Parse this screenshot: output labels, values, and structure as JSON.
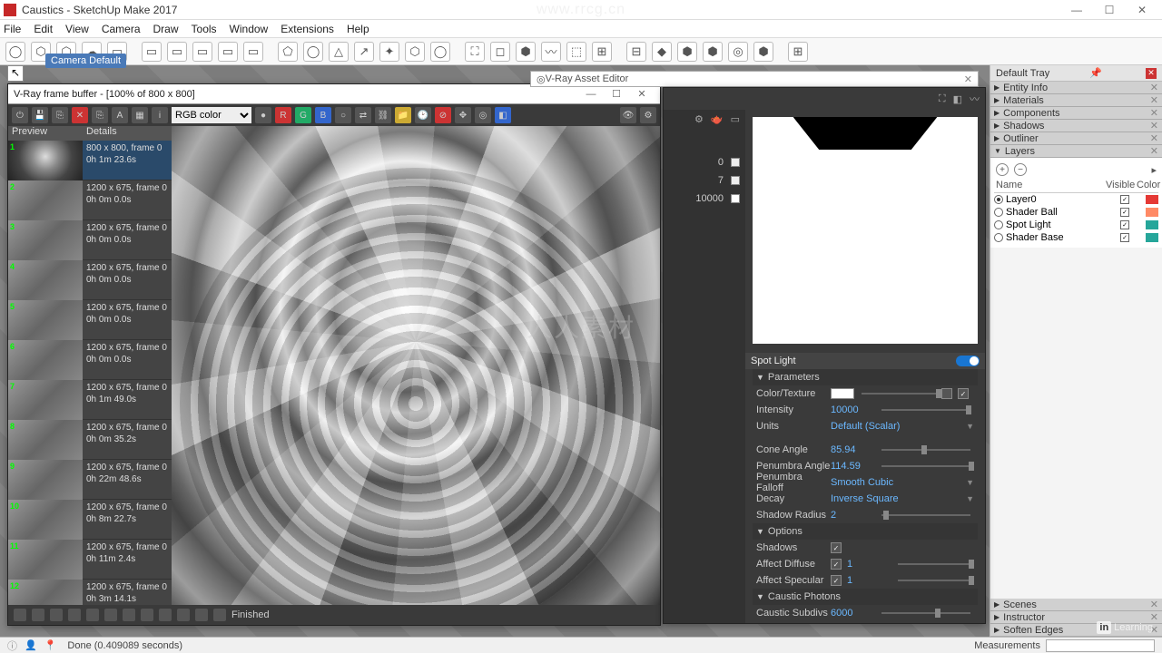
{
  "app": {
    "title": "Caustics - SketchUp Make 2017",
    "win_buttons": [
      "—",
      "☐",
      "✕"
    ]
  },
  "menu": [
    "File",
    "Edit",
    "View",
    "Camera",
    "Draw",
    "Tools",
    "Window",
    "Extensions",
    "Help"
  ],
  "camtip": "Camera Default",
  "toolbar_icons": [
    "◯",
    "⬡",
    "⬡",
    "☁",
    "▭",
    "▭",
    "▭",
    "▭",
    "▭",
    "▭",
    "⬠",
    "◯",
    "△",
    "↗",
    "✦",
    "⬡",
    "◯",
    "⛶",
    "◻",
    "⬢",
    "〰",
    "⬚",
    "⊞",
    "⊟",
    "◆",
    "⬢",
    "⬢",
    "◎",
    "⬢",
    "⊞"
  ],
  "vfb": {
    "title": "V-Ray frame buffer - [100% of 800 x 800]",
    "channel": "RGB color",
    "previews_hdr": {
      "c1": "Preview",
      "c2": "Details"
    },
    "list": [
      {
        "n": "1",
        "bw": true,
        "l1": "800 x 800, frame 0",
        "l2": "0h 1m 23.6s",
        "sel": true
      },
      {
        "n": "2",
        "l1": "1200 x 675, frame 0",
        "l2": "0h 0m 0.0s"
      },
      {
        "n": "3",
        "l1": "1200 x 675, frame 0",
        "l2": "0h 0m 0.0s"
      },
      {
        "n": "4",
        "l1": "1200 x 675, frame 0",
        "l2": "0h 0m 0.0s"
      },
      {
        "n": "5",
        "l1": "1200 x 675, frame 0",
        "l2": "0h 0m 0.0s"
      },
      {
        "n": "6",
        "l1": "1200 x 675, frame 0",
        "l2": "0h 0m 0.0s"
      },
      {
        "n": "7",
        "l1": "1200 x 675, frame 0",
        "l2": "0h 1m 49.0s"
      },
      {
        "n": "8",
        "l1": "1200 x 675, frame 0",
        "l2": "0h 0m 35.2s"
      },
      {
        "n": "9",
        "l1": "1200 x 675, frame 0",
        "l2": "0h 22m 48.6s"
      },
      {
        "n": "10",
        "l1": "1200 x 675, frame 0",
        "l2": "0h 8m 22.7s"
      },
      {
        "n": "11",
        "l1": "1200 x 675, frame 0",
        "l2": "0h 11m 2.4s"
      },
      {
        "n": "12",
        "l1": "1200 x 675, frame 0",
        "l2": "0h 3m 14.1s"
      }
    ],
    "status": "Finished"
  },
  "asset": {
    "tab": "V-Ray Asset Editor",
    "side_rows": [
      {
        "v": "0"
      },
      {
        "v": "7"
      },
      {
        "v": "10000"
      }
    ],
    "light_name": "Spot Light",
    "sections": {
      "parameters": "Parameters",
      "options": "Options",
      "caustic": "Caustic Photons"
    },
    "params": {
      "color_texture": {
        "lbl": "Color/Texture"
      },
      "intensity": {
        "lbl": "Intensity",
        "val": "10000"
      },
      "units": {
        "lbl": "Units",
        "val": "Default (Scalar)"
      },
      "cone_angle": {
        "lbl": "Cone Angle",
        "val": "85.94"
      },
      "penumbra_angle": {
        "lbl": "Penumbra Angle",
        "val": "114.59"
      },
      "penumbra_falloff": {
        "lbl": "Penumbra Falloff",
        "val": "Smooth Cubic"
      },
      "decay": {
        "lbl": "Decay",
        "val": "Inverse Square"
      },
      "shadow_radius": {
        "lbl": "Shadow Radius",
        "val": "2"
      }
    },
    "options": {
      "shadows": {
        "lbl": "Shadows",
        "chk": true
      },
      "affect_diffuse": {
        "lbl": "Affect Diffuse",
        "chk": true,
        "val": "1"
      },
      "affect_specular": {
        "lbl": "Affect Specular",
        "chk": true,
        "val": "1"
      }
    },
    "caustic": {
      "subdivs": {
        "lbl": "Caustic Subdivs",
        "val": "6000"
      }
    }
  },
  "tray": {
    "title": "Default Tray",
    "panels": [
      "Entity Info",
      "Materials",
      "Components",
      "Shadows",
      "Outliner",
      "Layers"
    ],
    "panels2": [
      "Scenes",
      "Instructor",
      "Soften Edges"
    ],
    "layers_hdr": {
      "c1": "Name",
      "c2": "Visible",
      "c3": "Color"
    },
    "layers": [
      {
        "name": "Layer0",
        "on": true,
        "color": "#e53935"
      },
      {
        "name": "Shader Ball",
        "on": false,
        "color": "#ff8a65"
      },
      {
        "name": "Spot Light",
        "on": false,
        "color": "#26a69a"
      },
      {
        "name": "Shader Base",
        "on": false,
        "color": "#26a69a"
      }
    ]
  },
  "status": {
    "text": "Done (0.409089 seconds)",
    "meas_lbl": "Measurements"
  },
  "watermarks": {
    "center": "人人素材",
    "top": "www.rrcg.cn",
    "li": "Learning"
  }
}
